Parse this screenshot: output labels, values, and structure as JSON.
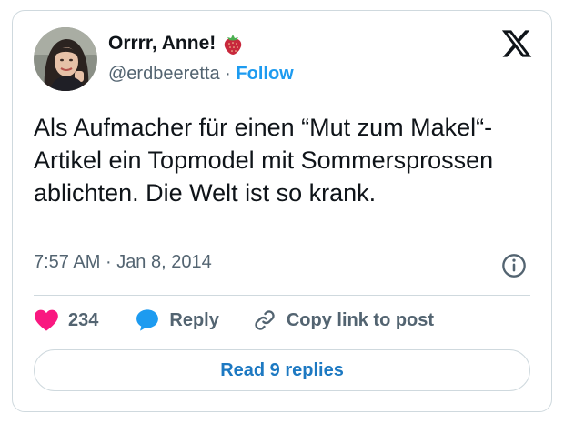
{
  "author": {
    "display_name": "Orrrr, Anne!",
    "name_emoji": "strawberry-icon",
    "handle": "@erdbeeretta",
    "separator": "·",
    "follow_label": "Follow"
  },
  "tweet": {
    "text": "Als Aufmacher für einen “Mut zum Makel“-Artikel ein Topmodel mit Sommersprossen ablichten. Die Welt ist so krank.",
    "time": "7:57 AM",
    "separator": "·",
    "date": "Jan 8, 2014"
  },
  "actions": {
    "like_count": "234",
    "reply_label": "Reply",
    "copy_link_label": "Copy link to post"
  },
  "footer": {
    "read_replies_label": "Read 9 replies"
  },
  "colors": {
    "like": "#f91880",
    "reply": "#1d9bf0",
    "link": "#1d79c2",
    "muted": "#536471",
    "border": "#cfd9de"
  }
}
